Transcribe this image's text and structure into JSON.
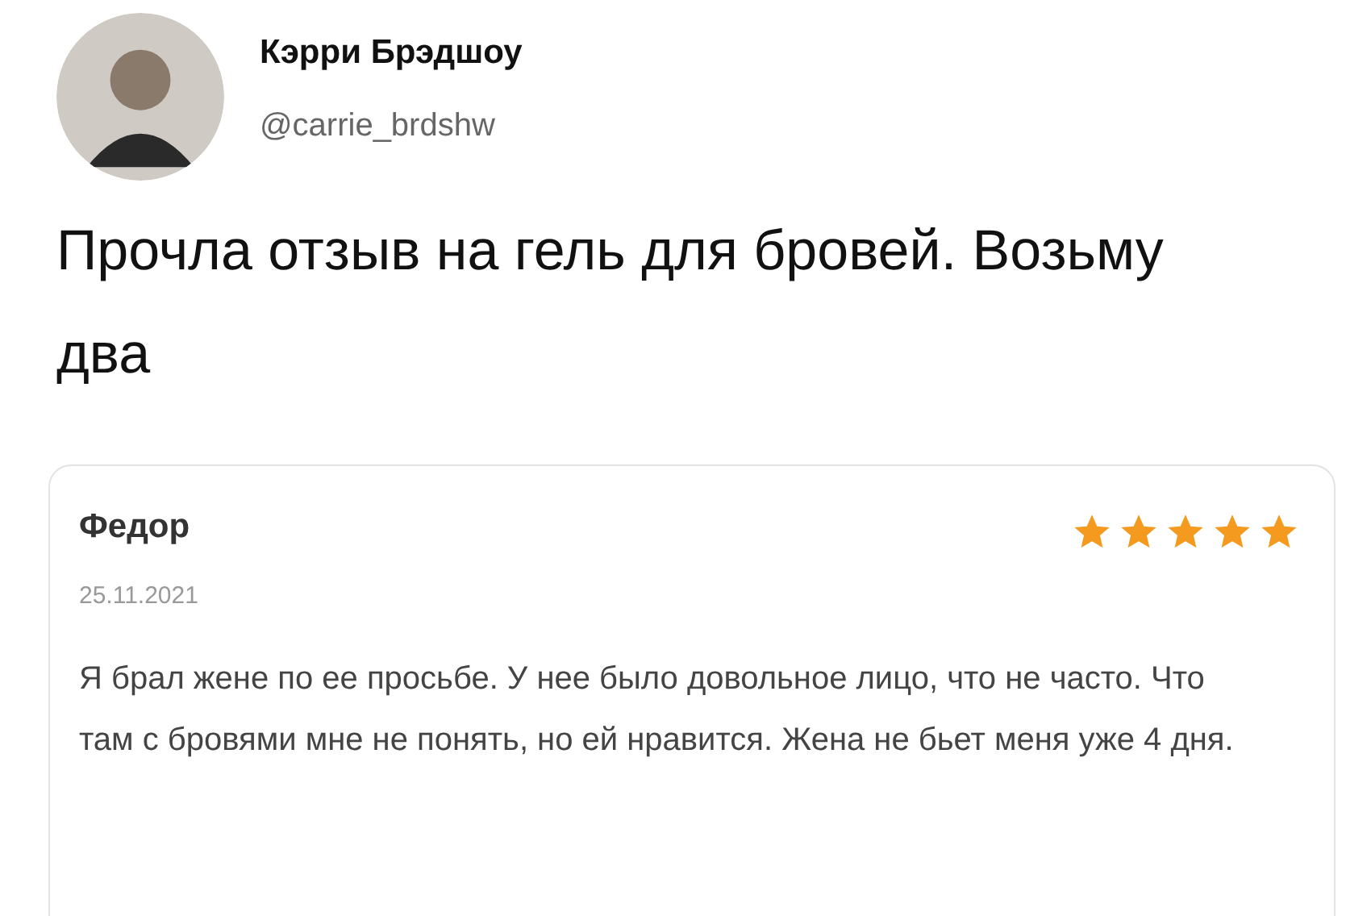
{
  "author": {
    "name": "Кэрри Брэдшоу",
    "handle": "@carrie_brdshw"
  },
  "tweet": {
    "text": "Прочла отзыв на гель для бровей. Возьму два"
  },
  "review": {
    "name": "Федор",
    "stars": 5,
    "date": "25.11.2021",
    "text": "Я брал жене по ее просьбе. У нее было довольное лицо, что не часто. Что там с бровями мне не понять, но ей нравится. Жена не бьет меня уже 4 дня."
  }
}
